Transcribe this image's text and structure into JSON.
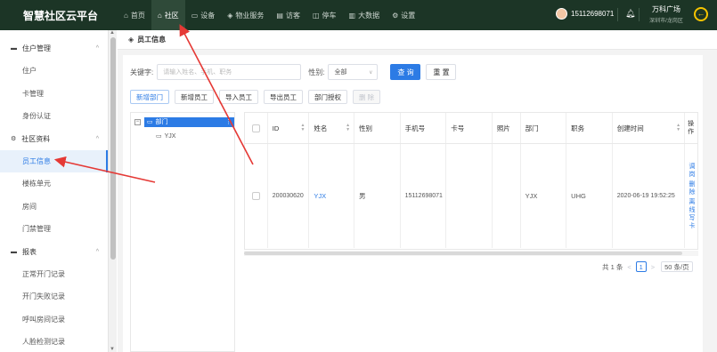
{
  "app": {
    "title": "智慧社区云平台"
  },
  "nav": [
    {
      "icon": "⌂",
      "icon_name": "home-icon",
      "label": "首页",
      "active": false
    },
    {
      "icon": "⌂",
      "icon_name": "community-icon",
      "label": "社区",
      "active": true
    },
    {
      "icon": "▭",
      "icon_name": "device-icon",
      "label": "设备",
      "active": false
    },
    {
      "icon": "◈",
      "icon_name": "property-icon",
      "label": "物业服务",
      "active": false
    },
    {
      "icon": "▤",
      "icon_name": "visitor-icon",
      "label": "访客",
      "active": false
    },
    {
      "icon": "◫",
      "icon_name": "parking-icon",
      "label": "停车",
      "active": false
    },
    {
      "icon": "▥",
      "icon_name": "bigdata-icon",
      "label": "大数据",
      "active": false
    },
    {
      "icon": "⚙",
      "icon_name": "gear-icon",
      "label": "设置",
      "active": false
    }
  ],
  "header": {
    "phone": "15112698071",
    "site_name": "万科广场",
    "site_city": "深圳市/龙岗区"
  },
  "sidebar": {
    "groups": [
      {
        "label": "住户管理",
        "items": [
          "住户",
          "卡管理",
          "身份认证"
        ]
      },
      {
        "label": "社区资料",
        "items": [
          "员工信息",
          "楼栋单元",
          "房间",
          "门禁管理"
        ]
      },
      {
        "label": "报表",
        "items": [
          "正常开门记录",
          "开门失败记录",
          "呼叫房间记录",
          "人脸检测记录"
        ]
      }
    ],
    "active": "员工信息"
  },
  "page": {
    "title": "员工信息"
  },
  "search": {
    "keyword_label": "关键字:",
    "keyword_placeholder": "请输入姓名、手机、职务",
    "gender_label": "性别:",
    "gender_value": "全部",
    "query_label": "查 询",
    "reset_label": "重 置"
  },
  "toolbar": {
    "new_dept": "新增部门",
    "new_staff": "新增员工",
    "import_staff": "导入员工",
    "export_staff": "导出员工",
    "door_auth": "部门授权",
    "delete": "删 除"
  },
  "tree": {
    "root": "部门",
    "child": "YJX"
  },
  "table": {
    "headers": [
      "ID",
      "姓名",
      "性别",
      "手机号",
      "卡号",
      "照片",
      "部门",
      "职务",
      "创建时间",
      "操作"
    ],
    "rows": [
      {
        "id": "200030620",
        "name": "YJX",
        "gender": "男",
        "phone": "15112698071",
        "card": "",
        "photo": "",
        "dept": "YJX",
        "title": "UHG",
        "created": "2020-06-19 19:52:25",
        "ops": [
          "调岗",
          "删除",
          "离线写卡"
        ]
      }
    ]
  },
  "pager": {
    "total": "共 1 条",
    "current": "1",
    "size": "50 条/页"
  }
}
